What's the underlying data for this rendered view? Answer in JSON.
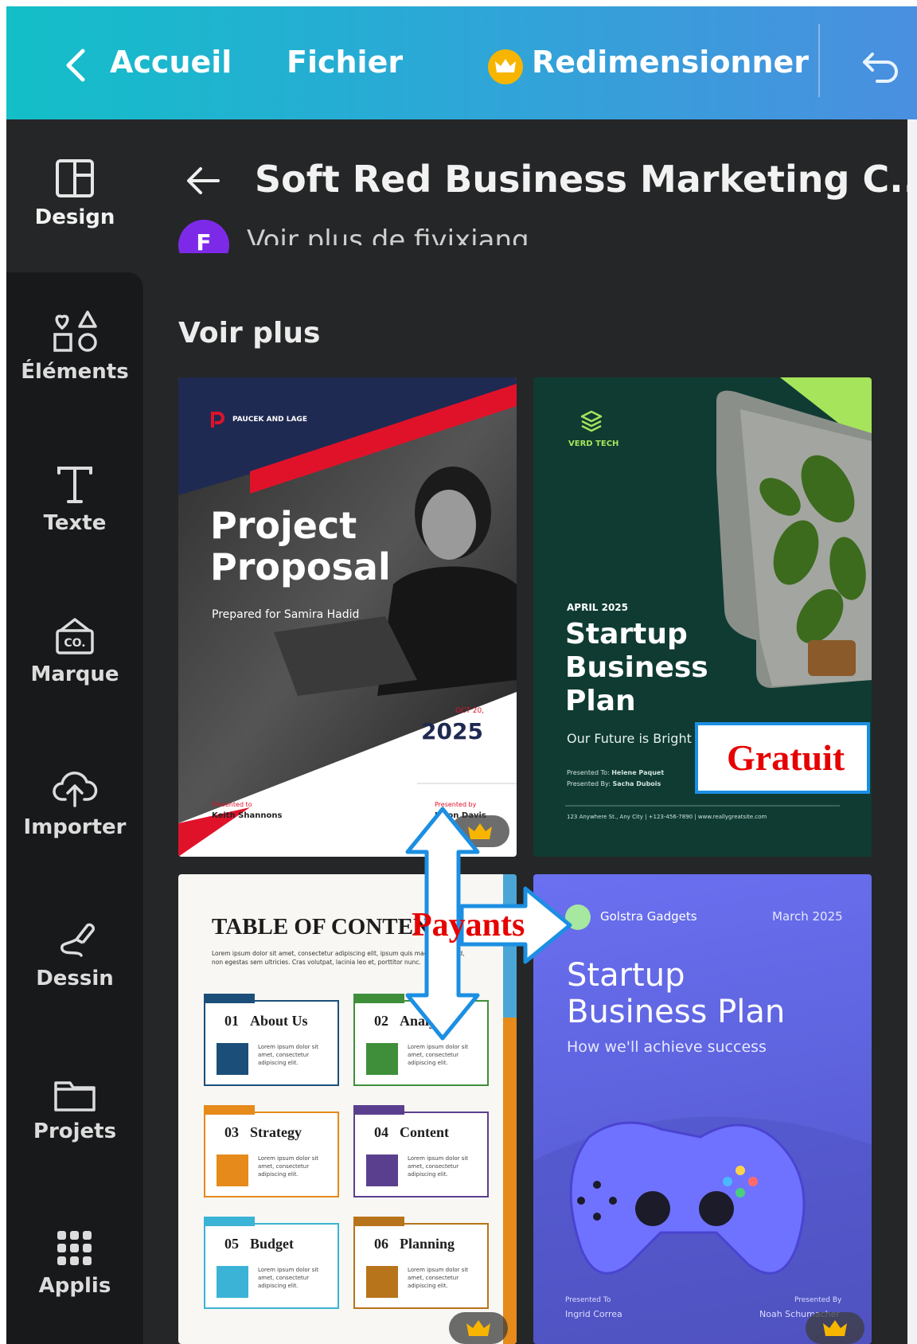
{
  "topbar": {
    "home_label": "Accueil",
    "file_label": "Fichier",
    "resize_label": "Redimensionner",
    "accent": "#13bfc8"
  },
  "sidebar": {
    "items": [
      {
        "label": "Design",
        "icon": "layout-icon"
      },
      {
        "label": "Éléments",
        "icon": "shapes-icon"
      },
      {
        "label": "Texte",
        "icon": "text-icon"
      },
      {
        "label": "Marque",
        "icon": "brand-icon"
      },
      {
        "label": "Importer",
        "icon": "upload-cloud-icon"
      },
      {
        "label": "Dessin",
        "icon": "draw-icon"
      },
      {
        "label": "Projets",
        "icon": "folder-icon"
      },
      {
        "label": "Applis",
        "icon": "apps-grid-icon"
      }
    ]
  },
  "panel": {
    "title": "Soft Red Business Marketing C...",
    "author_initial": "F",
    "author_link": "Voir plus de fiyixiang",
    "section_title": "Voir plus"
  },
  "templates": {
    "card1": {
      "brand": "PAUCEK AND LAGE",
      "title_line1": "Project",
      "title_line2": "Proposal",
      "subtitle": "Prepared for Samira Hadid",
      "date_small": "OCT 20,",
      "year": "2025",
      "presented_to_label": "Presented to",
      "presented_to_name": "Keith Shannons",
      "presented_by_label": "Presented by",
      "presented_by_name": "Jason Davis"
    },
    "card2": {
      "brand": "VERD TECH",
      "date": "APRIL 2025",
      "title_line1": "Startup",
      "title_line2": "Business",
      "title_line3": "Plan",
      "tagline": "Our Future is Bright",
      "presented_to": "Presented To:",
      "presented_to_name": "Helene Paquet",
      "presented_by": "Presented By:",
      "presented_by_name": "Sacha Dubois",
      "footer": "123 Anywhere St., Any City | +123-456-7890 | www.reallygreatsite.com"
    },
    "card3": {
      "title": "TABLE OF CONTENTS",
      "intro": "Lorem ipsum dolor sit amet, consectetur adipiscing elit, ipsum quis magna euismod, non egestas sem ultricies. Cras volutpat, lacinia leo et, porttitor nunc.",
      "lorem": "Lorem ipsum dolor sit amet, consectetur adipiscing elit.",
      "items": [
        {
          "num": "01",
          "label": "About Us",
          "color": "#1b4f7a"
        },
        {
          "num": "02",
          "label": "Analysis",
          "color": "#3f8f3a"
        },
        {
          "num": "03",
          "label": "Strategy",
          "color": "#e58a1b"
        },
        {
          "num": "04",
          "label": "Content",
          "color": "#5b3f8f"
        },
        {
          "num": "05",
          "label": "Budget",
          "color": "#3bb3d6"
        },
        {
          "num": "06",
          "label": "Planning",
          "color": "#b8741a"
        }
      ]
    },
    "card4": {
      "brand": "Golstra Gadgets",
      "date": "March 2025",
      "title_line1": "Startup",
      "title_line2": "Business Plan",
      "subtitle": "How we'll achieve success",
      "presented_to": "Presented To",
      "presented_to_name": "Ingrid Correa",
      "presented_by": "Presented By",
      "presented_by_name": "Noah Schumacher"
    }
  },
  "annotations": {
    "free_label": "Gratuit",
    "paid_label": "Payants"
  }
}
